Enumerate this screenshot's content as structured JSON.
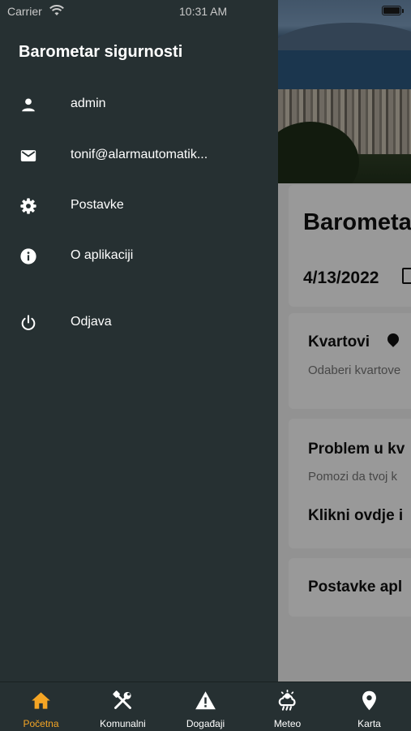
{
  "status_bar": {
    "carrier": "Carrier",
    "time": "10:31 AM"
  },
  "drawer": {
    "title": "Barometar sigurnosti",
    "items": [
      {
        "label": "admin",
        "icon": "person-icon"
      },
      {
        "label": "tonif@alarmautomatik...",
        "icon": "mail-icon"
      },
      {
        "label": "Postavke",
        "icon": "gear-icon"
      },
      {
        "label": "O aplikaciji",
        "icon": "info-icon"
      },
      {
        "label": "Odjava",
        "icon": "power-icon"
      }
    ]
  },
  "background": {
    "title": "Barometa",
    "date": "4/13/2022",
    "kvartovi_title": "Kvartovi",
    "kvartovi_sub": "Odaberi kvartove",
    "problem_title": "Problem u kv",
    "problem_sub": "Pomozi da tvoj k",
    "problem_link": "Klikni ovdje i",
    "postavke_title": "Postavke apl"
  },
  "tabbar": {
    "active_color": "#f5a524",
    "tabs": [
      {
        "label": "Početna",
        "icon": "home-icon"
      },
      {
        "label": "Komunalni",
        "icon": "tools-icon"
      },
      {
        "label": "Događaji",
        "icon": "warning-icon"
      },
      {
        "label": "Meteo",
        "icon": "weather-icon"
      },
      {
        "label": "Karta",
        "icon": "location-pin-icon"
      }
    ]
  }
}
